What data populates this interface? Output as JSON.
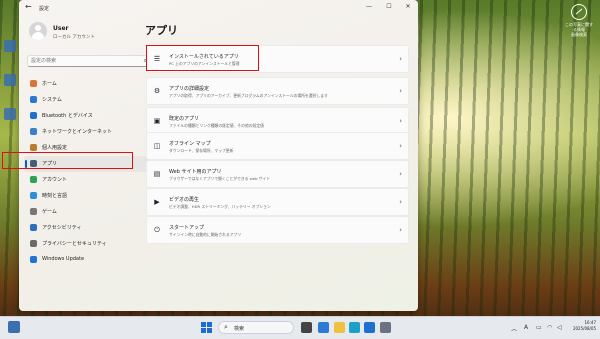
{
  "window": {
    "title": "設定",
    "controls": {
      "minimize": "—",
      "maximize": "☐",
      "close": "✕"
    }
  },
  "user": {
    "name": "User",
    "account_type": "ローカル アカウント"
  },
  "search": {
    "placeholder": "設定の検索"
  },
  "nav": {
    "items": [
      {
        "label": "ホーム",
        "icon": "home-icon",
        "color": "#d8743a"
      },
      {
        "label": "システム",
        "icon": "system-icon",
        "color": "#2b78d0"
      },
      {
        "label": "Bluetooth とデバイス",
        "icon": "bluetooth-icon",
        "color": "#1f6fd1"
      },
      {
        "label": "ネットワークとインターネット",
        "icon": "network-icon",
        "color": "#3d7fcf"
      },
      {
        "label": "個人用設定",
        "icon": "brush-icon",
        "color": "#c0792e"
      },
      {
        "label": "アプリ",
        "icon": "apps-icon",
        "color": "#4a5b78"
      },
      {
        "label": "アカウント",
        "icon": "account-icon",
        "color": "#2fa05a"
      },
      {
        "label": "時刻と言語",
        "icon": "globe-clock-icon",
        "color": "#2a8fd8"
      },
      {
        "label": "ゲーム",
        "icon": "gamepad-icon",
        "color": "#777777"
      },
      {
        "label": "アクセシビリティ",
        "icon": "accessibility-icon",
        "color": "#2a6fc0"
      },
      {
        "label": "プライバシーとセキュリティ",
        "icon": "shield-icon",
        "color": "#6a6a6a"
      },
      {
        "label": "Windows Update",
        "icon": "update-icon",
        "color": "#1f73d6"
      }
    ],
    "selected_index": 5
  },
  "page": {
    "title": "アプリ"
  },
  "cards": [
    {
      "title": "インストールされているアプリ",
      "subtitle": "PC 上のアプリのアンインストールと管理",
      "icon": "list-icon"
    },
    {
      "title": "アプリの詳細設定",
      "subtitle": "アプリの取得、アプリのアーカイブ、更新プログラムのアンインストールの場所を選択します",
      "icon": "app-settings-icon"
    },
    {
      "title": "既定のアプリ",
      "subtitle": "ファイルの種類とリンク種類の既定値、その他の既定値",
      "icon": "default-apps-icon"
    },
    {
      "title": "オフライン マップ",
      "subtitle": "ダウンロード、保存場所、マップ更新",
      "icon": "map-icon"
    },
    {
      "title": "Web サイト用のアプリ",
      "subtitle": "ブラウザーではなくアプリで開くことができる web サイト",
      "icon": "web-apps-icon"
    },
    {
      "title": "ビデオの再生",
      "subtitle": "ビデオ調整、HDR ストリーミング、バッテリー オプション",
      "icon": "video-icon"
    },
    {
      "title": "スタートアップ",
      "subtitle": "サインイン時に自動的に開始されるアプリ",
      "icon": "startup-icon"
    }
  ],
  "card_chevron": "›",
  "taskbar": {
    "search_label": "検索",
    "time": "16:47",
    "date": "2025/08/05",
    "tray_ime": "A",
    "apps": [
      {
        "icon": "task-view-icon",
        "color": "#444444"
      },
      {
        "icon": "widgets-icon",
        "color": "#2a7ad6"
      },
      {
        "icon": "file-explorer-icon",
        "color": "#f0c040"
      },
      {
        "icon": "edge-icon",
        "color": "#1ca0c8"
      },
      {
        "icon": "store-icon",
        "color": "#1e6fd0"
      },
      {
        "icon": "settings-icon",
        "color": "#6b7280"
      }
    ]
  },
  "desktop_corner": {
    "line1": "この写真に関する情報",
    "line2": "画像検索"
  }
}
